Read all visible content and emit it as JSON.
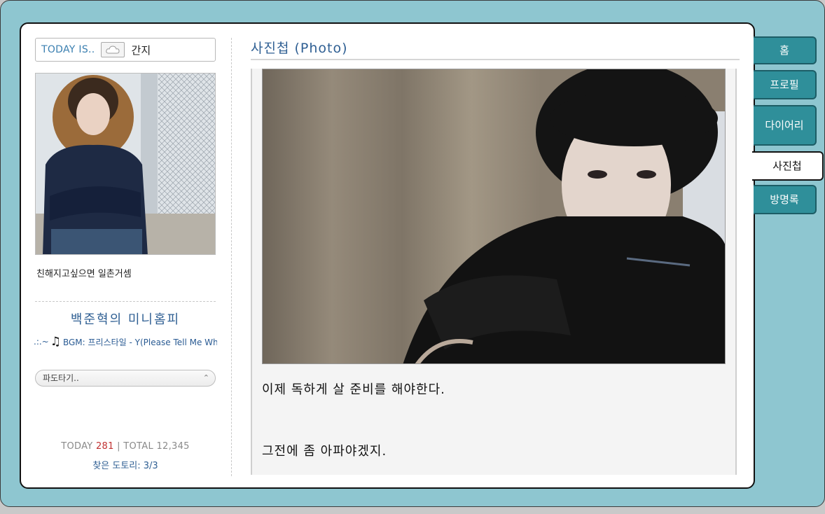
{
  "today": {
    "label": "TODAY IS..",
    "weather_icon": "cloud-icon",
    "mood": "간지"
  },
  "profile": {
    "intro": "친해지고싶으면 일촌거셈"
  },
  "home": {
    "title": "백준혁의 미니홈피",
    "bgm_prefix": ".:.~",
    "bgm_text": "BGM: 프리스타일 - Y(Please Tell Me Wh"
  },
  "dropdown": {
    "selected": "파도타기.."
  },
  "stats": {
    "today_label": "TODAY",
    "today_value": "281",
    "separator": "|",
    "total_label": "TOTAL",
    "total_value": "12,345",
    "acorn": "찾은 도토리: 3/3"
  },
  "section": {
    "title": "사진첩 (Photo)"
  },
  "post": {
    "line1": "이제 독하게 살 준비를 해야한다.",
    "line2": "그전에 좀 아파야겠지."
  },
  "tabs": [
    {
      "label": "홈"
    },
    {
      "label": "프로필"
    },
    {
      "label": "다이어리"
    },
    {
      "label": "사진첩"
    },
    {
      "label": "방명록"
    }
  ],
  "colors": {
    "frame": "#8ec6d0",
    "tab": "#2f8f9a",
    "title": "#2f5f93",
    "today_count": "#c03030"
  }
}
